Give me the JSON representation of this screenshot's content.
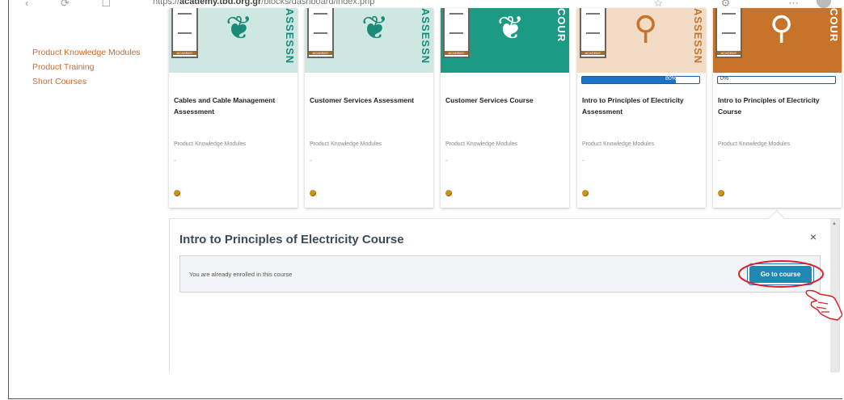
{
  "browser": {
    "url_prefix": "https://",
    "url_domain": "academy.tbd.org.gr",
    "url_path": "/blocks/dashboard/index.php"
  },
  "sidebar": {
    "items": [
      {
        "label": "Product Knowledge Modules"
      },
      {
        "label": "Product Training"
      },
      {
        "label": "Short Courses"
      }
    ]
  },
  "cards": [
    {
      "title": "Cables and Cable Management Assessment",
      "category": "Product Knowledge Modules",
      "extra": "-",
      "banner_text": "ASSESSN",
      "banner_color": "#cfe7e1",
      "text_color": "#1b8a78",
      "icon": "hands-icon"
    },
    {
      "title": "Customer Services Assessment",
      "category": "Product Knowledge Modules",
      "extra": "-",
      "banner_text": "ASSESSN",
      "banner_color": "#cfe7e1",
      "text_color": "#1b8a78",
      "icon": "hands-icon"
    },
    {
      "title": "Customer Services Course",
      "category": "Product Knowledge Modules",
      "extra": "-",
      "banner_text": "COUR",
      "banner_color": "#1b9a84",
      "text_color": "#ffffff",
      "icon": "hands-icon"
    },
    {
      "title": "Intro to Principles of Electricity Assessment",
      "category": "Product Knowledge Modules",
      "extra": "-",
      "banner_text": "ASSESSN",
      "banner_color": "#f3dcc6",
      "text_color": "#c7742a",
      "icon": "magnifier-bolt-icon",
      "progress": 80,
      "progress_label": "80%"
    },
    {
      "title": "Intro to Principles of Electricity Course",
      "category": "Product Knowledge Modules",
      "extra": "-",
      "banner_text": "COUR",
      "banner_color": "#c7742a",
      "text_color": "#ffffff",
      "icon": "magnifier-bolt-icon",
      "progress": 0,
      "progress_label": "0%"
    }
  ],
  "panel": {
    "title": "Intro to Principles of Electricity Course",
    "message": "You are already enrolled in this course",
    "button_label": "Go to course",
    "close_icon": "×"
  },
  "colors": {
    "link": "#d06a2a",
    "button": "#1f89b4",
    "annotation": "#d8232a"
  }
}
